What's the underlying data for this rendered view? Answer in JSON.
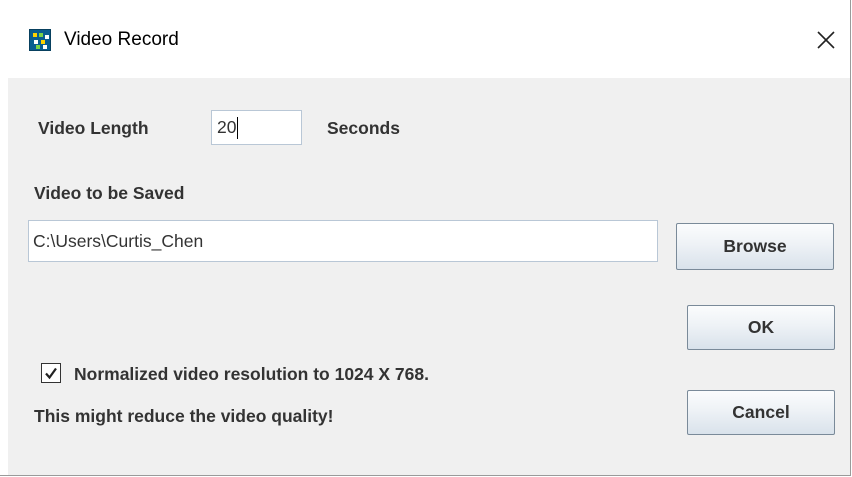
{
  "window": {
    "title": "Video Record",
    "close_glyph": "✕"
  },
  "video_length": {
    "label": "Video Length",
    "value": "20",
    "unit": "Seconds"
  },
  "save": {
    "label": "Video to be Saved",
    "path": "C:\\Users\\Curtis_Chen",
    "browse_label": "Browse"
  },
  "buttons": {
    "ok_label": "OK",
    "cancel_label": "Cancel"
  },
  "normalize": {
    "checked": true,
    "label": "Normalized video resolution to 1024 X 768.",
    "warning": "This might reduce the video quality!"
  },
  "icons": {
    "app": "video-record-app-icon",
    "close": "close-icon",
    "check": "checkmark-icon"
  },
  "colors": {
    "client_bg": "#f0f0f0",
    "field_border": "#b9c7d6",
    "button_border": "#7a8a99",
    "text": "#333333"
  }
}
